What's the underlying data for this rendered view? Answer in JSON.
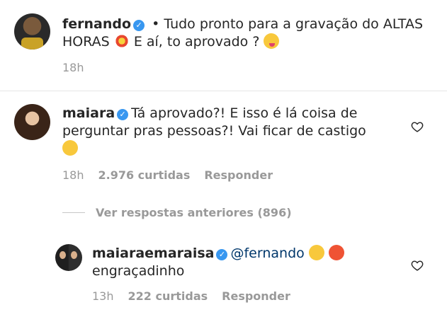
{
  "caption": {
    "username": "fernando",
    "bullet": " • ",
    "text_line1": "Tudo pronto para a gravação do ALTAS",
    "text_line2": "HORAS",
    "text_line2_end": "E aí, to aprovado ?",
    "timestamp": "18h"
  },
  "comment": {
    "username": "maiara",
    "text_line1": "Tá aprovado?! E isso é lá coisa de",
    "text_line2": "perguntar pras pessoas?! Vai ficar de castigo",
    "timestamp": "18h",
    "likes": "2.976 curtidas",
    "reply_label": "Responder"
  },
  "view_replies": {
    "label": "Ver respostas anteriores (896)"
  },
  "reply": {
    "username": "maiaraemaraisa",
    "mention": "@fernando",
    "text_line2": "engraçadinho",
    "timestamp": "13h",
    "likes": "222 curtidas",
    "reply_label": "Responder"
  },
  "icons": {
    "verified": "verified-badge-icon",
    "heart": "heart-outline-icon"
  },
  "colors": {
    "text": "#262626",
    "meta": "#999999",
    "verified": "#3897f0",
    "divider": "#e6e6e6"
  }
}
